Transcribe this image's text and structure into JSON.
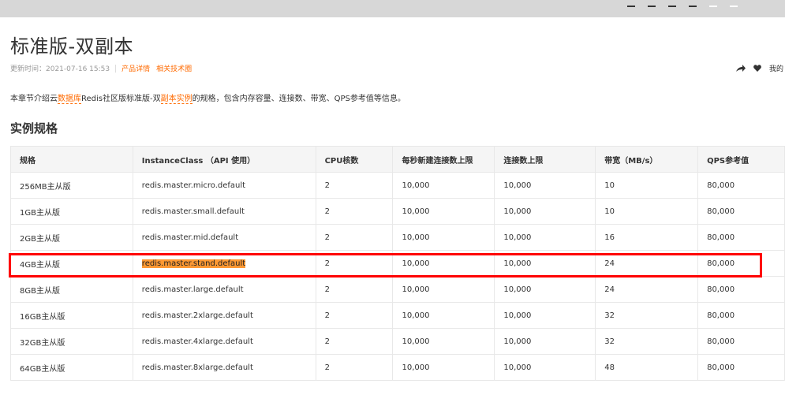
{
  "page": {
    "title": "标准版-双副本",
    "updated": "更新时间：2021-07-16 15:53",
    "links": [
      "产品详情",
      "相关技术圈"
    ],
    "actions": {
      "my_label": "我的"
    },
    "description": {
      "prefix": "本章节介绍云",
      "link1": "数据库",
      "middle": "Redis社区版标准版-双",
      "link2": "副本实例",
      "suffix": "的规格，包含内存容量、连接数、带宽、QPS参考值等信息。"
    },
    "section_title": "实例规格"
  },
  "table": {
    "headers": [
      "规格",
      "InstanceClass （API 使用）",
      "CPU核数",
      "每秒新建连接数上限",
      "连接数上限",
      "带宽（MB/s）",
      "QPS参考值"
    ],
    "rows": [
      [
        "256MB主从版",
        "redis.master.micro.default",
        "2",
        "10,000",
        "10,000",
        "10",
        "80,000"
      ],
      [
        "1GB主从版",
        "redis.master.small.default",
        "2",
        "10,000",
        "10,000",
        "10",
        "80,000"
      ],
      [
        "2GB主从版",
        "redis.master.mid.default",
        "2",
        "10,000",
        "10,000",
        "16",
        "80,000"
      ],
      [
        "4GB主从版",
        "redis.master.stand.default",
        "2",
        "10,000",
        "10,000",
        "24",
        "80,000"
      ],
      [
        "8GB主从版",
        "redis.master.large.default",
        "2",
        "10,000",
        "10,000",
        "24",
        "80,000"
      ],
      [
        "16GB主从版",
        "redis.master.2xlarge.default",
        "2",
        "10,000",
        "10,000",
        "32",
        "80,000"
      ],
      [
        "32GB主从版",
        "redis.master.4xlarge.default",
        "2",
        "10,000",
        "10,000",
        "32",
        "80,000"
      ],
      [
        "64GB主从版",
        "redis.master.8xlarge.default",
        "2",
        "10,000",
        "10,000",
        "48",
        "80,000"
      ]
    ]
  },
  "colors": {
    "accent": "#ff6a00",
    "highlight": "#ff9933",
    "annotation_box": "#ff0000"
  }
}
